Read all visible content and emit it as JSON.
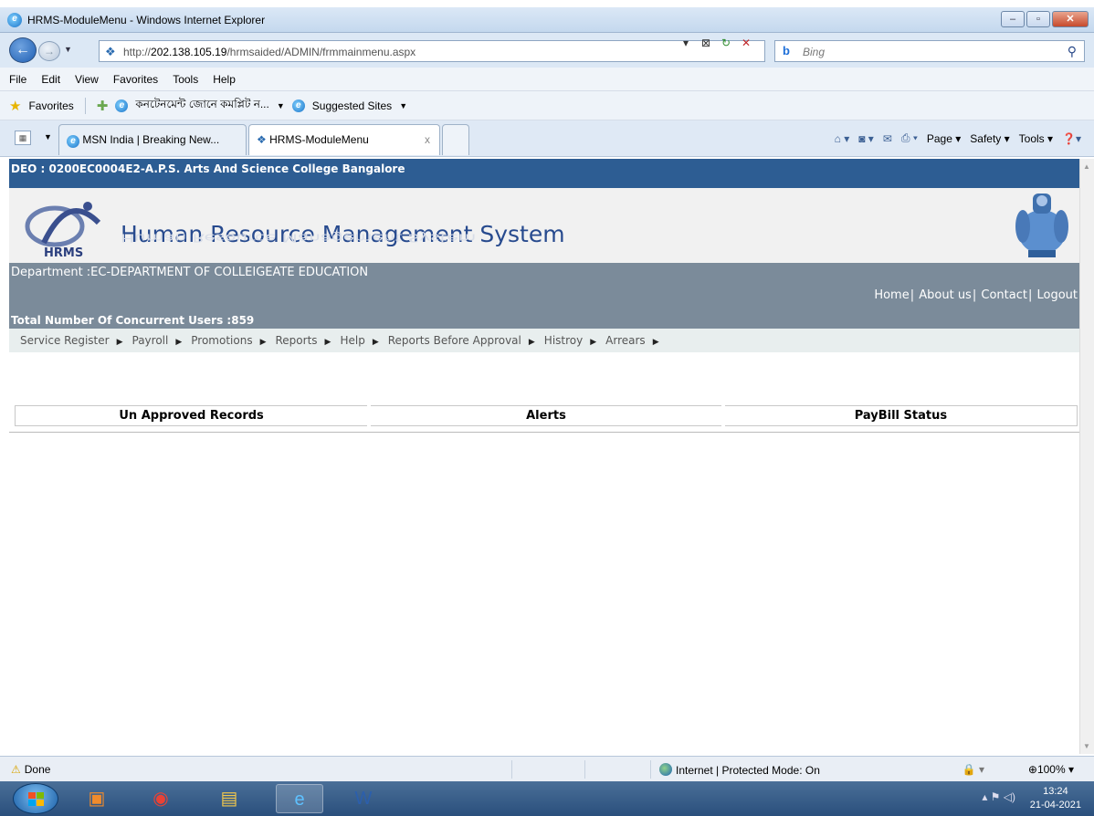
{
  "window": {
    "title": "HRMS-ModuleMenu - Windows Internet Explorer",
    "buttons": {
      "minimize": "–",
      "maximize": "▫",
      "close": "✕"
    }
  },
  "address": {
    "url_prefix": "http://",
    "url_host": "202.138.105.19",
    "url_path": "/hrmsaided/ADMIN/frmmainmenu.aspx",
    "search_placeholder": "Bing"
  },
  "menubar": [
    "File",
    "Edit",
    "View",
    "Favorites",
    "Tools",
    "Help"
  ],
  "favorites": {
    "label": "Favorites",
    "item1": "কনটেনমেন্ট জোনে কমপ্লিট ন...",
    "item2": "Suggested Sites"
  },
  "tabs": [
    {
      "label": "MSN India | Breaking New..."
    },
    {
      "label": "HRMS-ModuleMenu",
      "close": "x"
    }
  ],
  "commandbar": {
    "page": "Page",
    "safety": "Safety",
    "tools": "Tools"
  },
  "page": {
    "deo": "DEO : 0200EC0004E2-A.P.S. Arts And Science College Bangalore",
    "banner_title": "Human Resource Management System",
    "logo_text": "HRMS",
    "department": "Department :EC-DEPARTMENT OF COLLEIGEATE EDUCATION",
    "links": {
      "home": "Home",
      "about": "About us",
      "contact": "Contact",
      "logout": "Logout"
    },
    "users": "Total Number Of Concurrent Users :859",
    "menu": [
      "Service Register",
      "Payroll",
      "Promotions",
      "Reports",
      "Help",
      "Reports Before Approval",
      "Histroy",
      "Arrears"
    ],
    "columns": [
      "Un Approved Records",
      "Alerts",
      "PayBill Status"
    ]
  },
  "statusbar": {
    "status": "Done",
    "zone": "Internet | Protected Mode: On",
    "zoom": "100%"
  },
  "taskbar": {
    "time": "13:24",
    "date": "21-04-2021"
  },
  "colors": {
    "deo_bar": "#2d5d93",
    "dept_bar": "#7b8b9a",
    "banner_title": "#274a8e"
  }
}
